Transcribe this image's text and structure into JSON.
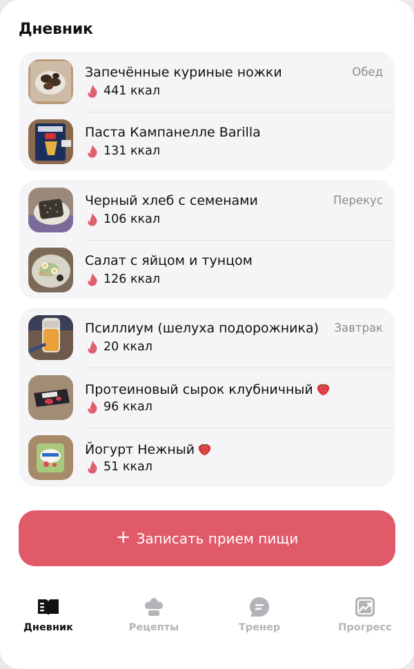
{
  "header": {
    "title": "Дневник"
  },
  "meals": [
    {
      "type": "Обед",
      "items": [
        {
          "name": "Запечённые куриные ножки",
          "kcal": "441 ккал"
        },
        {
          "name": "Паста Кампанелле Barilla",
          "kcal": "131 ккал"
        }
      ]
    },
    {
      "type": "Перекус",
      "items": [
        {
          "name": "Черный хлеб с семенами",
          "kcal": "106 ккал"
        },
        {
          "name": "Салат с яйцом и тунцом",
          "kcal": "126 ккал"
        }
      ]
    },
    {
      "type": "Завтрак",
      "items": [
        {
          "name": "Псиллиум (шелуха подорожника)",
          "kcal": "20 ккал"
        },
        {
          "name": "Протеиновый сырок клубничный",
          "kcal": "96 ккал",
          "emoji": "strawberry-icon"
        },
        {
          "name": "Йогурт Нежный",
          "kcal": "51 ккал",
          "emoji": "strawberry-icon"
        }
      ]
    }
  ],
  "add_button": {
    "icon": "plus-icon",
    "label": "Записать прием пищи"
  },
  "tabbar": {
    "tabs": [
      {
        "label": "Дневник",
        "icon": "book-icon",
        "active": true
      },
      {
        "label": "Рецепты",
        "icon": "chef-hat-icon",
        "active": false
      },
      {
        "label": "Тренер",
        "icon": "chat-bubble-icon",
        "active": false
      },
      {
        "label": "Прогресс",
        "icon": "progress-chart-icon",
        "active": false
      }
    ]
  },
  "colors": {
    "accent": "#e05a6a",
    "flame": "#e06070",
    "card_bg": "#f5f5f7",
    "muted_text": "#8b8b90",
    "tab_inactive": "#b3b3b8"
  }
}
